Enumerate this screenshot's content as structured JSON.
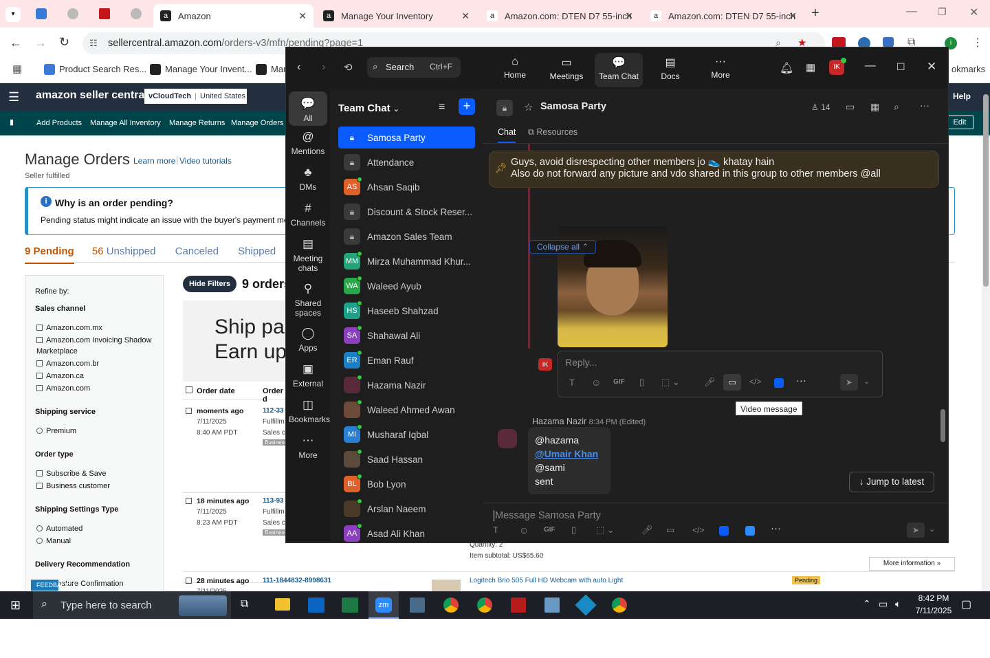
{
  "browser": {
    "tabs": [
      {
        "title": "Amazon",
        "active": true
      },
      {
        "title": "Manage Your Inventory",
        "active": false
      },
      {
        "title": "Amazon.com: DTEN D7 55-inch",
        "active": false
      },
      {
        "title": "Amazon.com: DTEN D7 55-inch",
        "active": false
      }
    ],
    "url_host": "sellercentral.amazon.com",
    "url_path": "/orders-v3/mfn/pending?page=1",
    "bookmarks": [
      "Product Search Res...",
      "Manage Your Invent...",
      "Mar"
    ],
    "bookmarks_right": "okmarks"
  },
  "amazon": {
    "logo": "amazon seller central",
    "account_name": "vCloudTech",
    "account_region": "United States",
    "help": "Help",
    "nav": [
      "Add Products",
      "Manage All Inventory",
      "Manage Returns",
      "Manage Orders"
    ],
    "edit": "Edit",
    "page_title": "Manage Orders",
    "learn_more": "Learn more",
    "video_tutorials": "Video tutorials",
    "seller_fulfilled": "Seller fulfilled",
    "notice_title": "Why is an order pending?",
    "notice_body": "Pending status might indicate an issue with the buyer's payment meth",
    "tabs": [
      {
        "count": "9",
        "label": "Pending"
      },
      {
        "count": "56",
        "label": "Unshipped"
      },
      {
        "count": "",
        "label": "Canceled"
      },
      {
        "count": "",
        "label": "Shipped"
      }
    ],
    "refine_by": "Refine by:",
    "filters": [
      {
        "heading": "Sales channel",
        "type": "checkbox",
        "options": [
          "Amazon.com.mx",
          "Amazon.com Invoicing Shadow Marketplace",
          "Amazon.com.br",
          "Amazon.ca",
          "Amazon.com"
        ]
      },
      {
        "heading": "Shipping service",
        "type": "radio",
        "options": [
          "Premium"
        ]
      },
      {
        "heading": "Order type",
        "type": "checkbox",
        "options": [
          "Subscribe & Save",
          "Business customer"
        ]
      },
      {
        "heading": "Shipping Settings Type",
        "type": "radio",
        "options": [
          "Automated",
          "Manual"
        ]
      },
      {
        "heading": "Delivery Recommendation",
        "type": "checkbox",
        "options": [
          "Signature Confirmation"
        ]
      }
    ],
    "hide_filters": "Hide Filters",
    "orders_count": "9 orders",
    "banner_line1": "Ship pac",
    "banner_line2": "Earn up",
    "col_order_date": "Order date",
    "col_order": "Order d",
    "orders": [
      {
        "ago": "moments ago",
        "date": "7/11/2025",
        "time": "8:40 AM PDT",
        "id": "112-33",
        "f1": "Fulfillm",
        "f2": "Sales ch",
        "badge": "Business"
      },
      {
        "ago": "18 minutes ago",
        "date": "7/11/2025",
        "time": "8:23 AM PDT",
        "id": "113-93",
        "f1": "Fulfillm",
        "f2": "Sales ch",
        "badge": "Business"
      },
      {
        "ago": "28 minutes ago",
        "date": "7/11/2025",
        "time": "",
        "id": "111-1844832-8998631",
        "f1": "",
        "f2": "",
        "badge": ""
      }
    ],
    "quantity": "Quantity: 2",
    "item_subtotal": "Item subtotal: US$65.60",
    "more_info": "More information »",
    "product_title": "Logitech Brio 505 Full HD Webcam with auto Light",
    "pending_badge": "Pending",
    "feedback": "FEEDBACK"
  },
  "zoom": {
    "search_label": "Search",
    "search_shortcut": "Ctrl+F",
    "nav": [
      "Home",
      "Meetings",
      "Team Chat",
      "Docs",
      "More"
    ],
    "user_initials": "IK",
    "rail": [
      "All",
      "Mentions",
      "DMs",
      "Channels",
      "Meeting chats",
      "Shared spaces",
      "Apps",
      "External",
      "Bookmarks",
      "More"
    ],
    "list_title": "Team Chat",
    "channels": [
      {
        "name": "Samosa Party",
        "kind": "lock",
        "selected": true
      },
      {
        "name": "Attendance",
        "kind": "lock"
      },
      {
        "name": "Ahsan Saqib",
        "kind": "avatar",
        "initials": "AS",
        "color": "#e0602a"
      },
      {
        "name": "Discount & Stock Reser...",
        "kind": "lock"
      },
      {
        "name": "Amazon Sales Team",
        "kind": "lock"
      },
      {
        "name": "Mirza Muhammad Khur...",
        "kind": "avatar",
        "initials": "MM",
        "color": "#22a37a"
      },
      {
        "name": "Waleed Ayub",
        "kind": "avatar",
        "initials": "WA",
        "color": "#29a84a"
      },
      {
        "name": "Haseeb Shahzad",
        "kind": "avatar",
        "initials": "HS",
        "color": "#1fa08a"
      },
      {
        "name": "Shahawal Ali",
        "kind": "avatar",
        "initials": "SA",
        "color": "#8c3fbf"
      },
      {
        "name": "Eman Rauf",
        "kind": "avatar",
        "initials": "ER",
        "color": "#1a7fc4"
      },
      {
        "name": "Hazama Nazir",
        "kind": "avatar",
        "initials": "",
        "color": "#5a2a3a"
      },
      {
        "name": "Waleed Ahmed Awan",
        "kind": "avatar",
        "initials": "",
        "color": "#6b4a3a"
      },
      {
        "name": "Musharaf Iqbal",
        "kind": "avatar",
        "initials": "MI",
        "color": "#2a7fd4"
      },
      {
        "name": "Saad Hassan",
        "kind": "avatar",
        "initials": "",
        "color": "#5a4a3a"
      },
      {
        "name": "Bob Lyon",
        "kind": "avatar",
        "initials": "BL",
        "color": "#e0602a"
      },
      {
        "name": "Arslan Naeem",
        "kind": "avatar",
        "initials": "",
        "color": "#4a3a2a"
      },
      {
        "name": "Asad Ali Khan",
        "kind": "avatar",
        "initials": "AA",
        "color": "#8c3fbf"
      }
    ],
    "channel_title": "Samosa Party",
    "member_count": "14",
    "tab_chat": "Chat",
    "tab_resources": "Resources",
    "pinned_line1": "Guys, avoid disrespecting other members jo 👟 khatay hain",
    "pinned_line2": "Also do not forward any picture and vdo shared in this group to other members @all",
    "collapse_all": "Collapse all",
    "reply_placeholder": "Reply...",
    "reply_avatar": "IK",
    "tooltip": "Video message",
    "msg_author": "Hazama Nazir",
    "msg_time": "8:34 PM (Edited)",
    "msg_lines": [
      "@hazama",
      "@Umair Khan",
      "@sami",
      "sent"
    ],
    "jump_latest": "Jump to latest",
    "composer_placeholder": "Message Samosa Party"
  },
  "taskbar": {
    "search_placeholder": "Type here to search",
    "time": "8:42 PM",
    "date": "7/11/2025"
  }
}
